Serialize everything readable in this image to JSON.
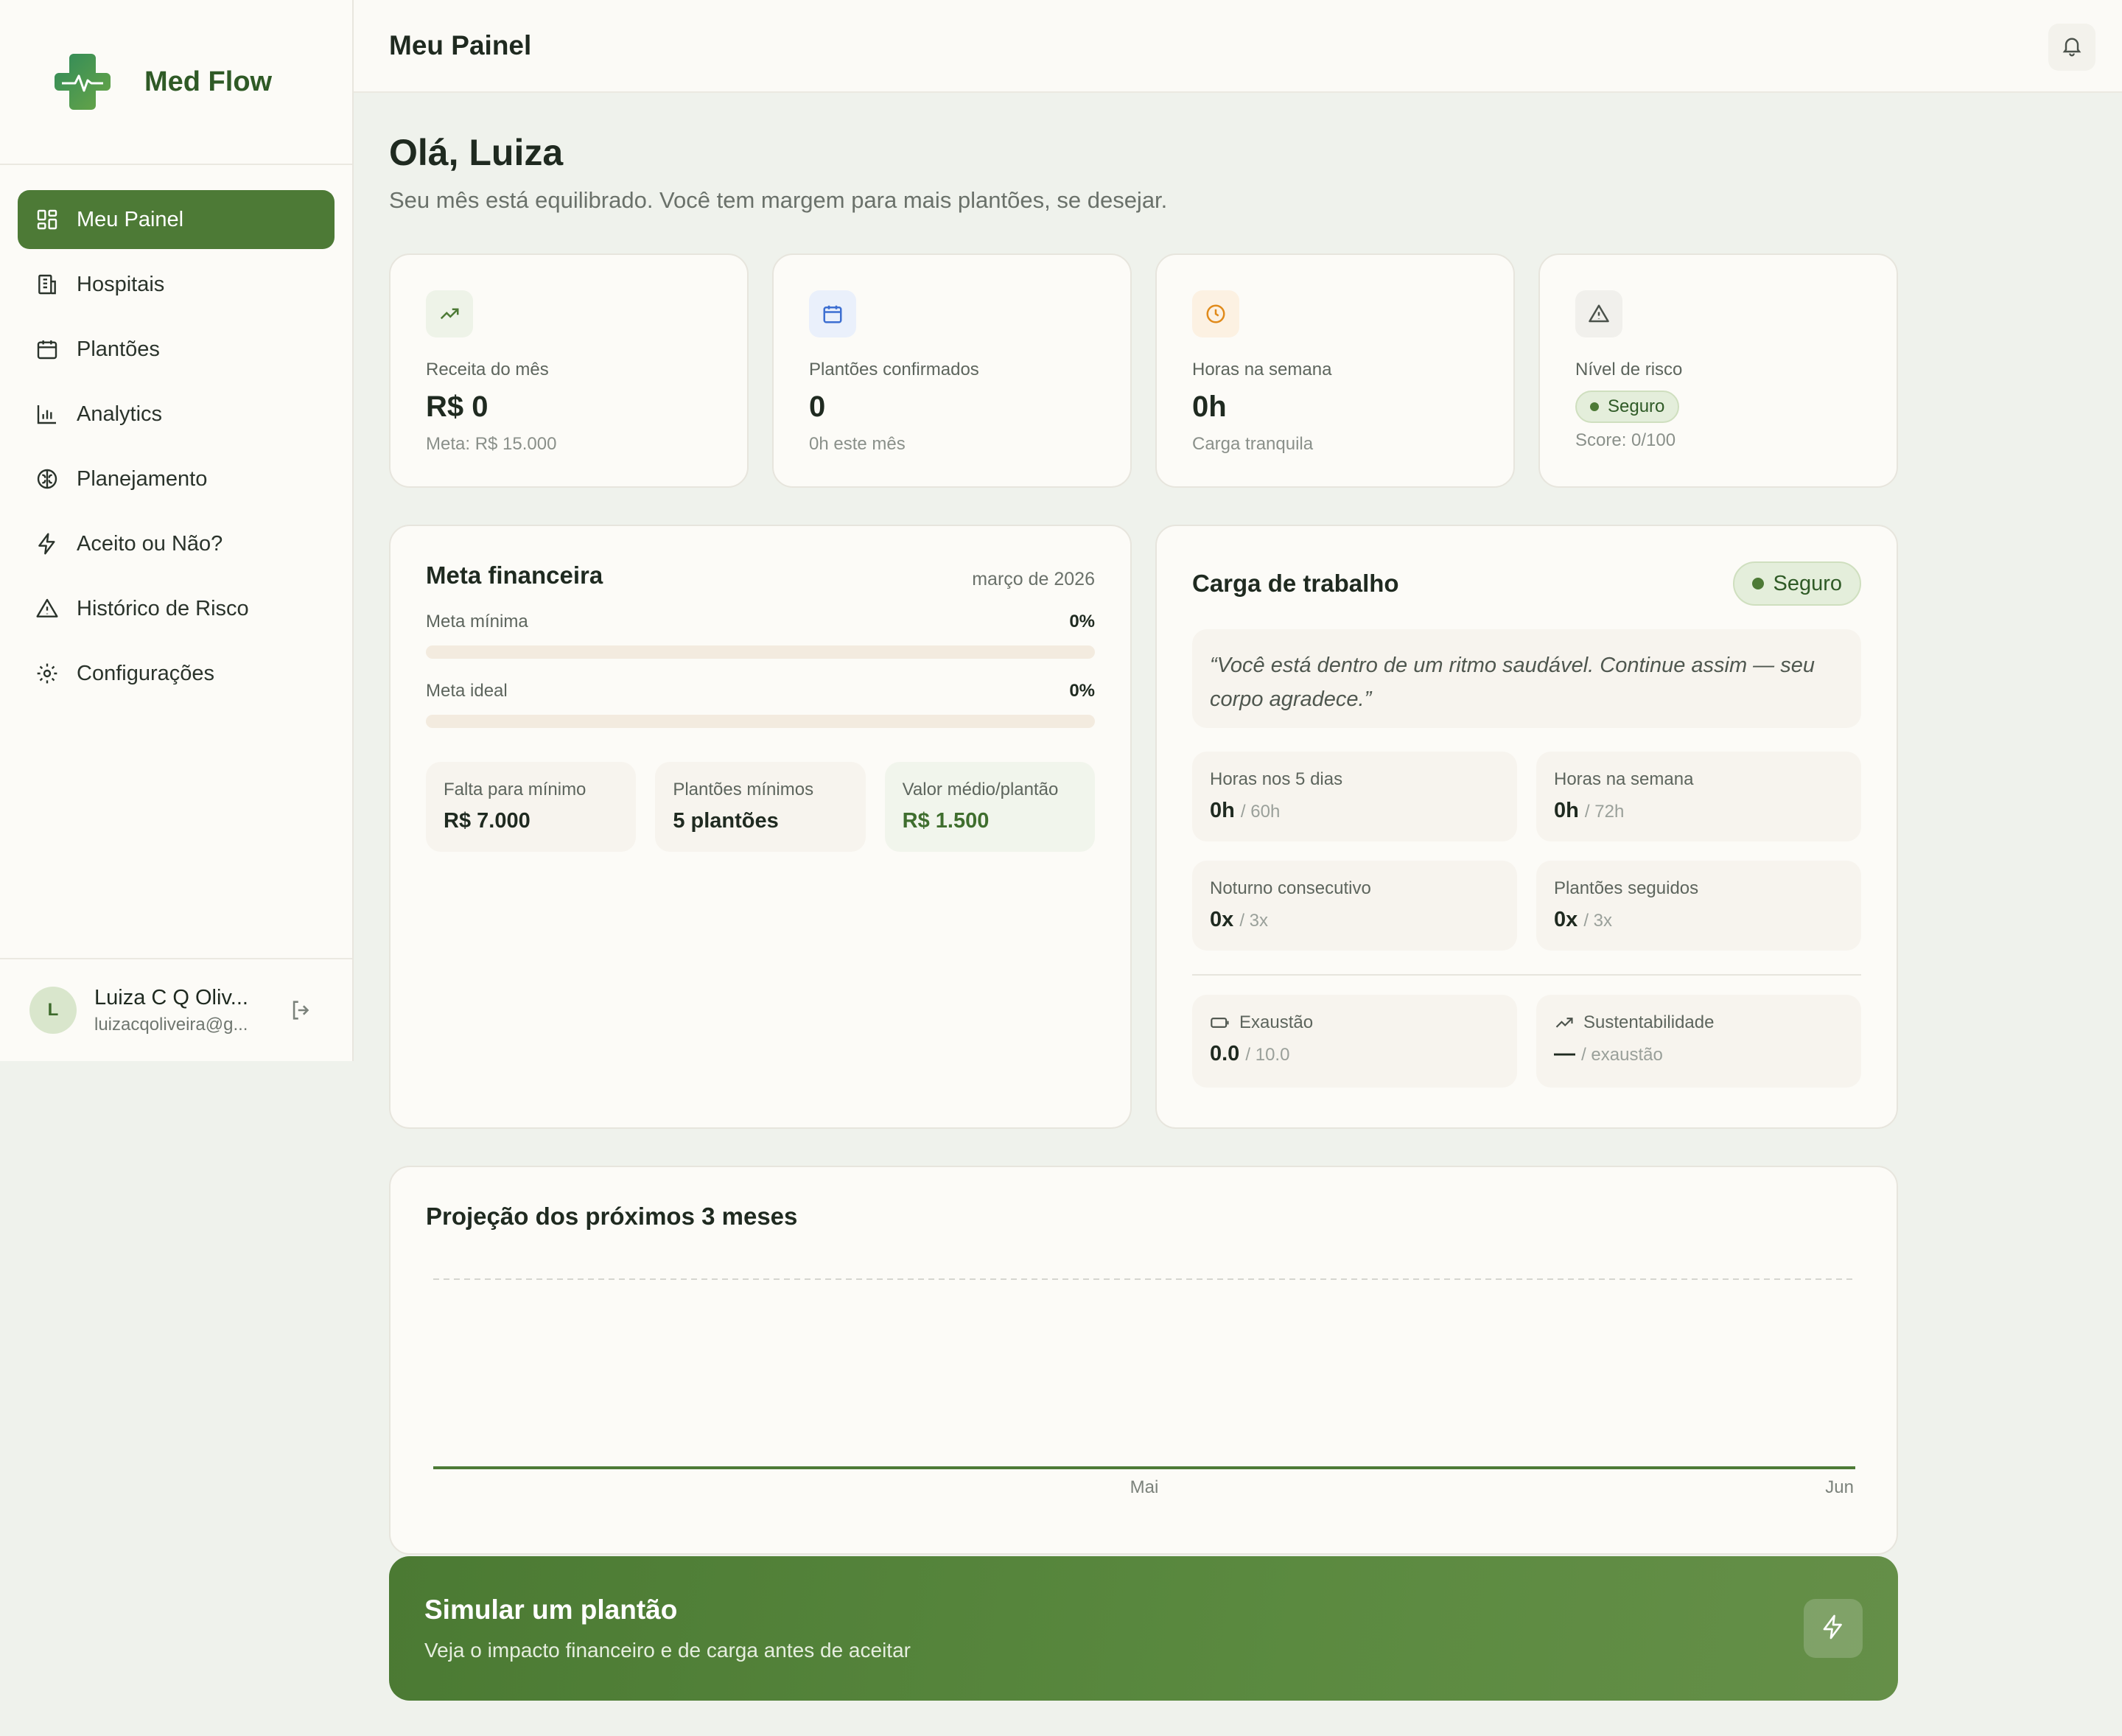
{
  "brand": {
    "name": "Med Flow"
  },
  "sidebar": {
    "items": [
      {
        "label": "Meu Painel",
        "icon": "dashboard-icon"
      },
      {
        "label": "Hospitais",
        "icon": "building-icon"
      },
      {
        "label": "Plantões",
        "icon": "calendar-icon"
      },
      {
        "label": "Analytics",
        "icon": "bar-chart-icon"
      },
      {
        "label": "Planejamento",
        "icon": "brain-icon"
      },
      {
        "label": "Aceito ou Não?",
        "icon": "lightning-icon"
      },
      {
        "label": "Histórico de Risco",
        "icon": "warning-icon"
      },
      {
        "label": "Configurações",
        "icon": "gear-icon"
      }
    ],
    "user": {
      "initial": "L",
      "name": "Luiza C Q Oliv...",
      "email": "luizacqoliveira@g..."
    }
  },
  "header": {
    "title": "Meu Painel"
  },
  "greeting": {
    "title": "Olá, Luiza",
    "subtitle": "Seu mês está equilibrado. Você tem margem para mais plantões, se desejar."
  },
  "kpis": [
    {
      "label": "Receita do mês",
      "value": "R$ 0",
      "note": "Meta: R$ 15.000",
      "icon": "trending-up-icon",
      "color": "#4d7a36"
    },
    {
      "label": "Plantões confirmados",
      "value": "0",
      "note": "0h este mês",
      "icon": "calendar-icon",
      "color": "#3d6fd1"
    },
    {
      "label": "Horas na semana",
      "value": "0h",
      "note": "Carga tranquila",
      "icon": "clock-icon",
      "color": "#e08a1a"
    },
    {
      "label": "Nível de risco",
      "badge": "Seguro",
      "note": "Score: 0/100",
      "icon": "warning-icon",
      "color": "#4b524b"
    }
  ],
  "meta": {
    "title": "Meta financeira",
    "date": "março de 2026",
    "progress": [
      {
        "label": "Meta mínima",
        "value": "0%",
        "fraction": 0
      },
      {
        "label": "Meta ideal",
        "value": "0%",
        "fraction": 0
      }
    ],
    "stats": [
      {
        "label": "Falta para mínimo",
        "value": "R$ 7.000"
      },
      {
        "label": "Plantões mínimos",
        "value": "5 plantões"
      },
      {
        "label": "Valor médio/plantão",
        "value": "R$ 1.500"
      }
    ]
  },
  "load": {
    "title": "Carga de trabalho",
    "badge": "Seguro",
    "quote": "“Você está dentro de um ritmo saudável. Continue assim — seu corpo agradece.”",
    "stats": [
      {
        "label": "Horas nos 5 dias",
        "value": "0h",
        "limit": "/ 60h"
      },
      {
        "label": "Horas na semana",
        "value": "0h",
        "limit": "/ 72h"
      },
      {
        "label": "Noturno consecutivo",
        "value": "0x",
        "limit": "/ 3x"
      },
      {
        "label": "Plantões seguidos",
        "value": "0x",
        "limit": "/ 3x"
      }
    ],
    "extra": [
      {
        "label": "Exaustão",
        "value": "0.0",
        "limit": "/ 10.0",
        "icon": "battery-icon"
      },
      {
        "label": "Sustentabilidade",
        "value": "—",
        "limit": "/ exaustão",
        "icon": "trending-up-icon"
      }
    ]
  },
  "projection": {
    "title": "Projeção dos próximos 3 meses"
  },
  "chart_data": {
    "type": "area",
    "categories": [
      "Mai",
      "Jun"
    ],
    "x": [
      "",
      "Mai",
      "Jun"
    ],
    "values": [
      0,
      0,
      0
    ],
    "reference_line": "dashed",
    "color": "#4d7a36",
    "title": "Projeção dos próximos 3 meses",
    "xlabel": "",
    "ylabel": ""
  },
  "cta": {
    "title": "Simular um plantão",
    "subtitle": "Veja o impacto financeiro e de carga antes de aceitar"
  }
}
